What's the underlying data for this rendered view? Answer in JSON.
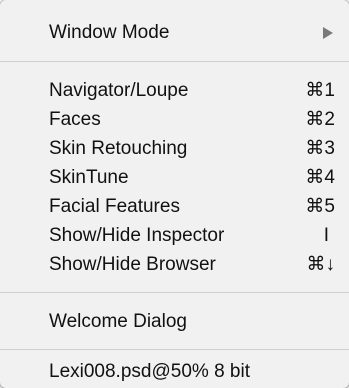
{
  "menu": {
    "window_mode": {
      "label": "Window Mode",
      "submenu_icon": "triangle-right-icon"
    },
    "items": [
      {
        "label": "Navigator/Loupe",
        "shortcut": "⌘1"
      },
      {
        "label": "Faces",
        "shortcut": "⌘2"
      },
      {
        "label": "Skin Retouching",
        "shortcut": "⌘3"
      },
      {
        "label": "SkinTune",
        "shortcut": "⌘4"
      },
      {
        "label": "Facial Features",
        "shortcut": "⌘5"
      },
      {
        "label": "Show/Hide Inspector",
        "shortcut": "I"
      },
      {
        "label": "Show/Hide Browser",
        "shortcut": "⌘↓"
      }
    ],
    "welcome_dialog": {
      "label": "Welcome Dialog"
    },
    "document": {
      "label": "Lexi008.psd@50% 8 bit"
    }
  },
  "colors": {
    "menu_background": "#f1f1f1",
    "text": "#111111",
    "separator": "#cfcfcf"
  }
}
